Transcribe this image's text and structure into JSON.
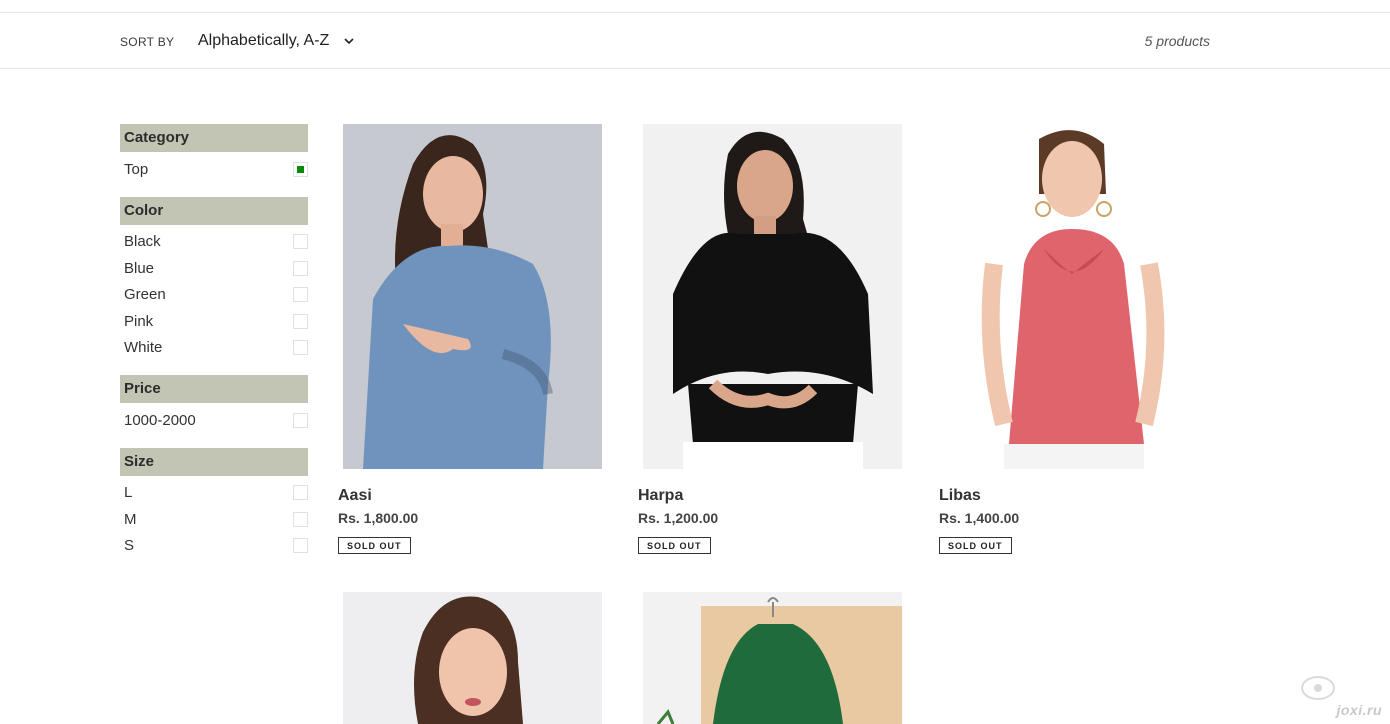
{
  "toolbar": {
    "sort_label": "SORT BY",
    "sort_value": "Alphabetically, A-Z",
    "product_count": "5 products"
  },
  "filters": [
    {
      "title": "Category",
      "items": [
        {
          "label": "Top",
          "checked": true
        }
      ]
    },
    {
      "title": "Color",
      "items": [
        {
          "label": "Black",
          "checked": false
        },
        {
          "label": "Blue",
          "checked": false
        },
        {
          "label": "Green",
          "checked": false
        },
        {
          "label": "Pink",
          "checked": false
        },
        {
          "label": "White",
          "checked": false
        }
      ]
    },
    {
      "title": "Price",
      "items": [
        {
          "label": "1000-2000",
          "checked": false
        }
      ]
    },
    {
      "title": "Size",
      "items": [
        {
          "label": "L",
          "checked": false
        },
        {
          "label": "M",
          "checked": false
        },
        {
          "label": "S",
          "checked": false
        }
      ]
    }
  ],
  "products": [
    {
      "name": "Aasi",
      "price": "Rs. 1,800.00",
      "badge": "SOLD OUT",
      "garment_color": "#6f93bd"
    },
    {
      "name": "Harpa",
      "price": "Rs. 1,200.00",
      "badge": "SOLD OUT",
      "garment_color": "#111111"
    },
    {
      "name": "Libas",
      "price": "Rs. 1,400.00",
      "badge": "SOLD OUT",
      "garment_color": "#e0646c"
    },
    {
      "name": "",
      "price": "",
      "badge": "",
      "garment_color": "#f2f2f2"
    },
    {
      "name": "",
      "price": "",
      "badge": "",
      "garment_color": "#1f6b3c"
    }
  ],
  "watermark": "joxi.ru",
  "colors": {
    "filter_header": "#c2c4b4",
    "checked_green": "#0a8a0a"
  }
}
